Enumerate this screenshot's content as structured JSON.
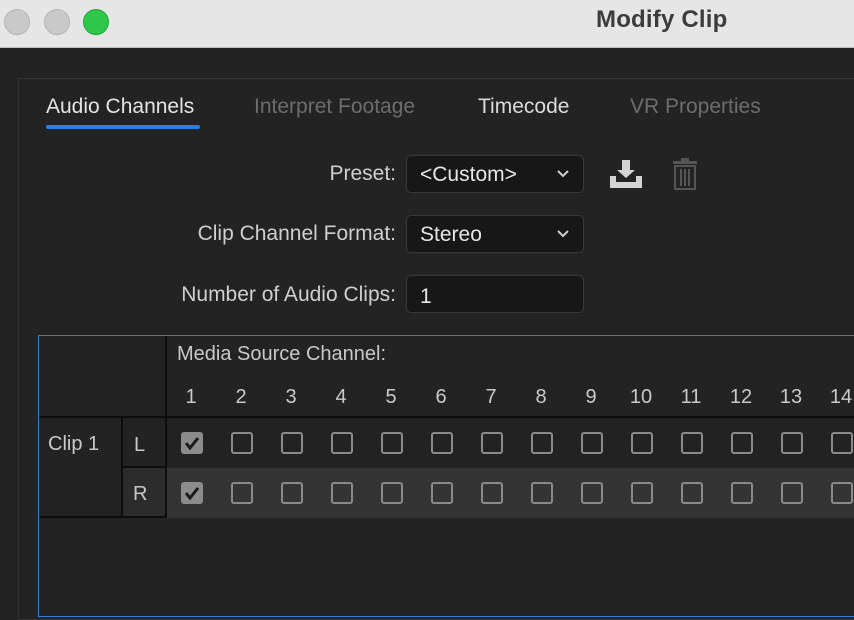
{
  "window": {
    "title": "Modify Clip"
  },
  "tabs": [
    {
      "label": "Audio Channels",
      "active": true
    },
    {
      "label": "Interpret Footage",
      "active": false
    },
    {
      "label": "Timecode",
      "active": false
    },
    {
      "label": "VR Properties",
      "active": false
    }
  ],
  "form": {
    "preset_label": "Preset:",
    "preset_value": "<Custom>",
    "format_label": "Clip Channel Format:",
    "format_value": "Stereo",
    "clips_label": "Number of Audio Clips:",
    "clips_value": "1"
  },
  "grid": {
    "header": "Media Source Channel:",
    "columns": [
      "1",
      "2",
      "3",
      "4",
      "5",
      "6",
      "7",
      "8",
      "9",
      "10",
      "11",
      "12",
      "13",
      "14"
    ],
    "clip_label": "Clip 1",
    "rows": [
      {
        "channel": "L",
        "checked": [
          true,
          false,
          false,
          false,
          false,
          false,
          false,
          false,
          false,
          false,
          false,
          false,
          false,
          false
        ]
      },
      {
        "channel": "R",
        "checked": [
          true,
          false,
          false,
          false,
          false,
          false,
          false,
          false,
          false,
          false,
          false,
          false,
          false,
          false
        ]
      }
    ]
  },
  "colors": {
    "accent": "#2a7ee6",
    "close_light": "#c9c9c9",
    "zoom_light": "#2fc84a"
  }
}
